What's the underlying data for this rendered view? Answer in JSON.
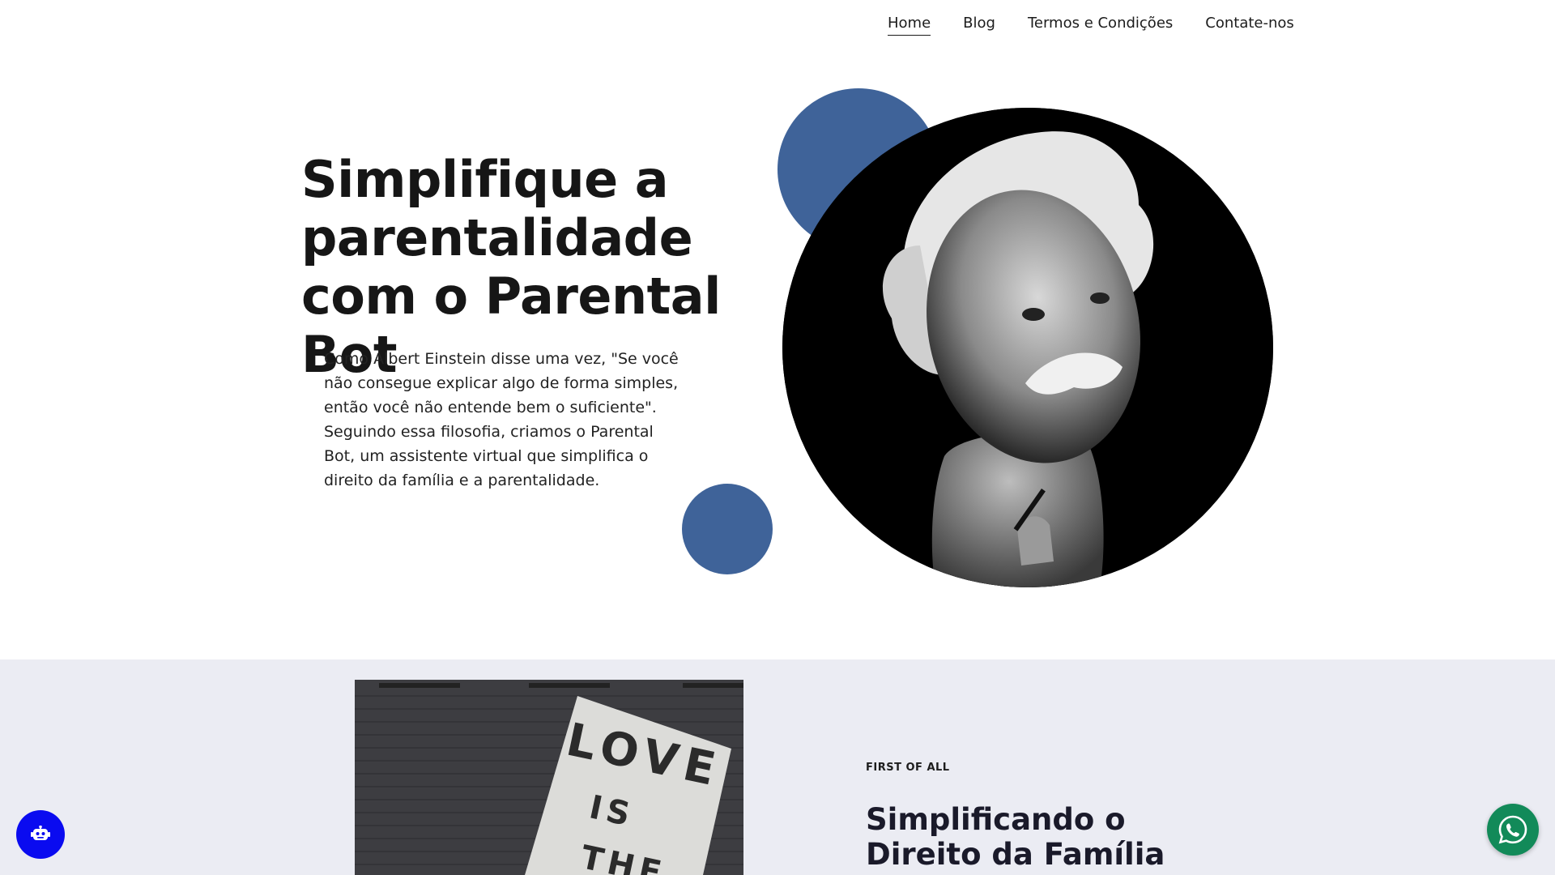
{
  "nav": {
    "items": [
      {
        "label": "Home",
        "active": true
      },
      {
        "label": "Blog",
        "active": false
      },
      {
        "label": "Termos e Condições",
        "active": false
      },
      {
        "label": "Contate-nos",
        "active": false
      }
    ]
  },
  "hero": {
    "title": "Simplifique a parentalidade com o Parental Bot",
    "description": "Como Albert Einstein disse uma vez, \"Se você não consegue explicar algo de forma simples, então você não entende bem o suficiente\". Seguindo essa filosofia, criamos o Parental Bot, um assistente virtual que simplifica o direito da família e a parentalidade.",
    "accent_color": "#3f6399"
  },
  "section": {
    "eyebrow": "FIRST OF ALL",
    "title": "Simplificando o Direito da Família",
    "background": "#ebecf3",
    "image_sign_text": [
      "LOVE",
      "IS",
      "THE"
    ]
  },
  "floating": {
    "bot_icon": "robot-icon",
    "bot_color": "#0a0bf0",
    "whatsapp_icon": "whatsapp-icon",
    "whatsapp_color": "#128a59"
  }
}
